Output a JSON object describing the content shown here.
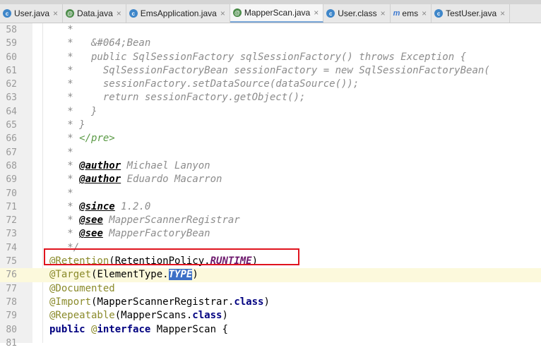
{
  "tabs": [
    {
      "label": "User.java",
      "icon": "class-c-icon"
    },
    {
      "label": "Data.java",
      "icon": "annotation-g-icon"
    },
    {
      "label": "EmsApplication.java",
      "icon": "class-c-icon"
    },
    {
      "label": "MapperScan.java",
      "icon": "annotation-g-icon",
      "active": true
    },
    {
      "label": "User.class",
      "icon": "class-c-icon"
    },
    {
      "label": "ems",
      "icon": "module-m-icon"
    },
    {
      "label": "TestUser.java",
      "icon": "class-c-icon"
    }
  ],
  "close_glyph": "×",
  "editor": {
    "lines": [
      {
        "n": "58",
        "parts": [
          [
            "cm",
            "   *"
          ]
        ]
      },
      {
        "n": "59",
        "parts": [
          [
            "cm",
            "   *   &#064;Bean"
          ]
        ]
      },
      {
        "n": "60",
        "parts": [
          [
            "cm",
            "   *   public SqlSessionFactory sqlSessionFactory() throws Exception {"
          ]
        ]
      },
      {
        "n": "61",
        "parts": [
          [
            "cm",
            "   *     SqlSessionFactoryBean sessionFactory = new SqlSessionFactoryBean("
          ]
        ]
      },
      {
        "n": "62",
        "parts": [
          [
            "cm",
            "   *     sessionFactory.setDataSource(dataSource());"
          ]
        ]
      },
      {
        "n": "63",
        "parts": [
          [
            "cm",
            "   *     return sessionFactory.getObject();"
          ]
        ]
      },
      {
        "n": "64",
        "parts": [
          [
            "cm",
            "   *   }"
          ]
        ]
      },
      {
        "n": "65",
        "parts": [
          [
            "cm",
            "   * }"
          ]
        ]
      },
      {
        "n": "66",
        "parts": [
          [
            "cm",
            "   * "
          ],
          [
            "tagg",
            "</pre>"
          ]
        ]
      },
      {
        "n": "67",
        "parts": [
          [
            "cm",
            "   *"
          ]
        ]
      },
      {
        "n": "68",
        "parts": [
          [
            "cm",
            "   * "
          ],
          [
            "tag",
            "@author"
          ],
          [
            "cm",
            " Michael Lanyon"
          ]
        ]
      },
      {
        "n": "69",
        "parts": [
          [
            "cm",
            "   * "
          ],
          [
            "tag",
            "@author"
          ],
          [
            "cm",
            " Eduardo Macarron"
          ]
        ]
      },
      {
        "n": "70",
        "parts": [
          [
            "cm",
            "   *"
          ]
        ]
      },
      {
        "n": "71",
        "parts": [
          [
            "cm",
            "   * "
          ],
          [
            "tag",
            "@since"
          ],
          [
            "cm",
            " 1.2.0"
          ]
        ]
      },
      {
        "n": "72",
        "parts": [
          [
            "cm",
            "   * "
          ],
          [
            "tag",
            "@see"
          ],
          [
            "cm",
            " MapperScannerRegistrar"
          ]
        ]
      },
      {
        "n": "73",
        "parts": [
          [
            "cm",
            "   * "
          ],
          [
            "tag",
            "@see"
          ],
          [
            "cm",
            " MapperFactoryBean"
          ]
        ]
      },
      {
        "n": "74",
        "parts": [
          [
            "cm",
            "   */"
          ]
        ]
      },
      {
        "n": "75",
        "parts": [
          [
            "ann",
            "@Retention"
          ],
          [
            "pl",
            "(RetentionPolicy."
          ],
          [
            "cst",
            "RUNTIME"
          ],
          [
            "pl",
            ")"
          ]
        ]
      },
      {
        "n": "76",
        "cur": true,
        "parts": [
          [
            "ann",
            "@Target"
          ],
          [
            "pl",
            "(ElementType."
          ],
          [
            "sel",
            "TYPE"
          ],
          [
            "pl",
            ")"
          ]
        ]
      },
      {
        "n": "77",
        "parts": [
          [
            "ann",
            "@Documented"
          ]
        ]
      },
      {
        "n": "78",
        "parts": [
          [
            "ann",
            "@Import"
          ],
          [
            "pl",
            "(MapperScannerRegistrar."
          ],
          [
            "kw",
            "class"
          ],
          [
            "pl",
            ")"
          ]
        ]
      },
      {
        "n": "79",
        "parts": [
          [
            "ann",
            "@Repeatable"
          ],
          [
            "pl",
            "(MapperScans."
          ],
          [
            "kw",
            "class"
          ],
          [
            "pl",
            ")"
          ]
        ]
      },
      {
        "n": "80",
        "parts": [
          [
            "kw",
            "public"
          ],
          [
            "pl",
            " "
          ],
          [
            "ann",
            "@"
          ],
          [
            "kw",
            "interface"
          ],
          [
            "pl",
            " MapperScan {"
          ]
        ]
      },
      {
        "n": "81",
        "parts": [
          [
            "pl",
            ""
          ]
        ]
      }
    ]
  }
}
